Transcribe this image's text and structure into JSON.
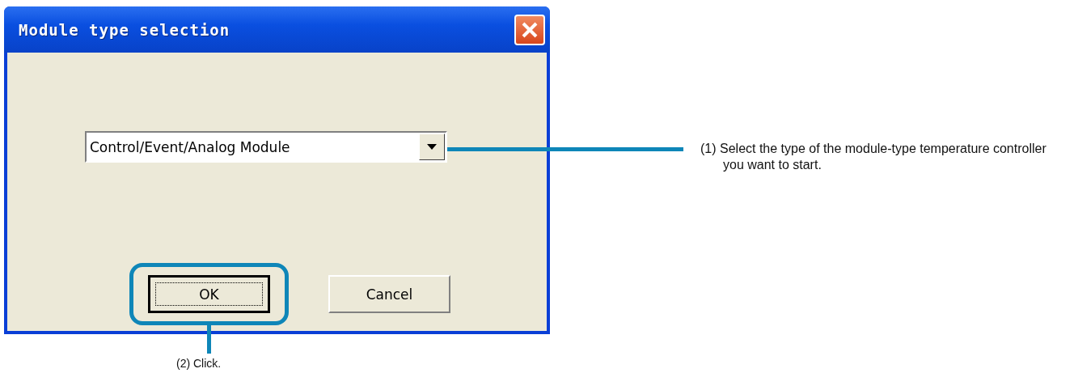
{
  "dialog": {
    "title": "Module type selection",
    "dropdown": {
      "value": "Control/Event/Analog Module"
    },
    "buttons": [
      {
        "label": "OK",
        "focused": true
      },
      {
        "label": "Cancel",
        "focused": false
      }
    ]
  },
  "callouts": [
    {
      "text": "(1) Select the type of the module-type temperature controller you want to start."
    },
    {
      "text": "(2) Click."
    }
  ]
}
